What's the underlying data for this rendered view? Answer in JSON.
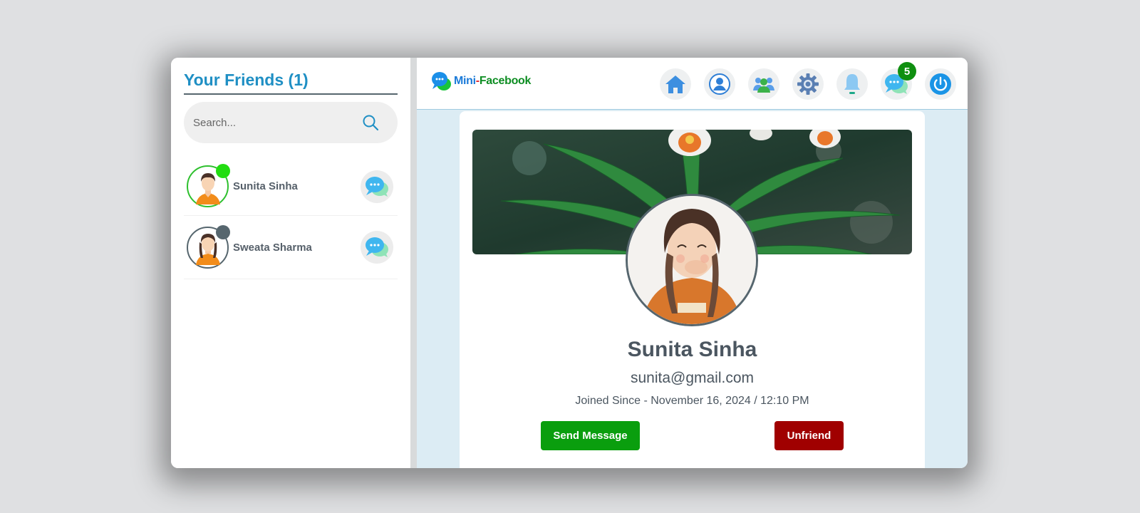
{
  "sidebar": {
    "title": "Your Friends (1)",
    "search": {
      "placeholder": "Search...",
      "value": ""
    },
    "friends": [
      {
        "name": "Sunita Sinha",
        "status": "online",
        "avatar": "female-short-hair-avatar"
      },
      {
        "name": "Sweata Sharma",
        "status": "offline",
        "avatar": "female-braids-avatar"
      }
    ]
  },
  "header": {
    "logo": {
      "part1": "Mini",
      "dash": "-",
      "part2": "Facebook"
    },
    "nav": [
      "home-icon",
      "profile-icon",
      "friends-icon",
      "settings-icon",
      "notifications-icon",
      "messages-icon",
      "power-icon"
    ],
    "messages_badge": "5"
  },
  "profile": {
    "name": "Sunita Sinha",
    "email": "sunita@gmail.com",
    "joined": "Joined Since - November 16, 2024 / 12:10 PM",
    "send_message_label": "Send Message",
    "unfriend_label": "Unfriend"
  },
  "colors": {
    "accent": "#1f8fc4",
    "online": "#22dd11",
    "offline": "#56666e",
    "send": "#0a9e0e",
    "unfriend": "#a00000",
    "badge": "#0f8f10",
    "main_bg": "#dcecf4"
  }
}
